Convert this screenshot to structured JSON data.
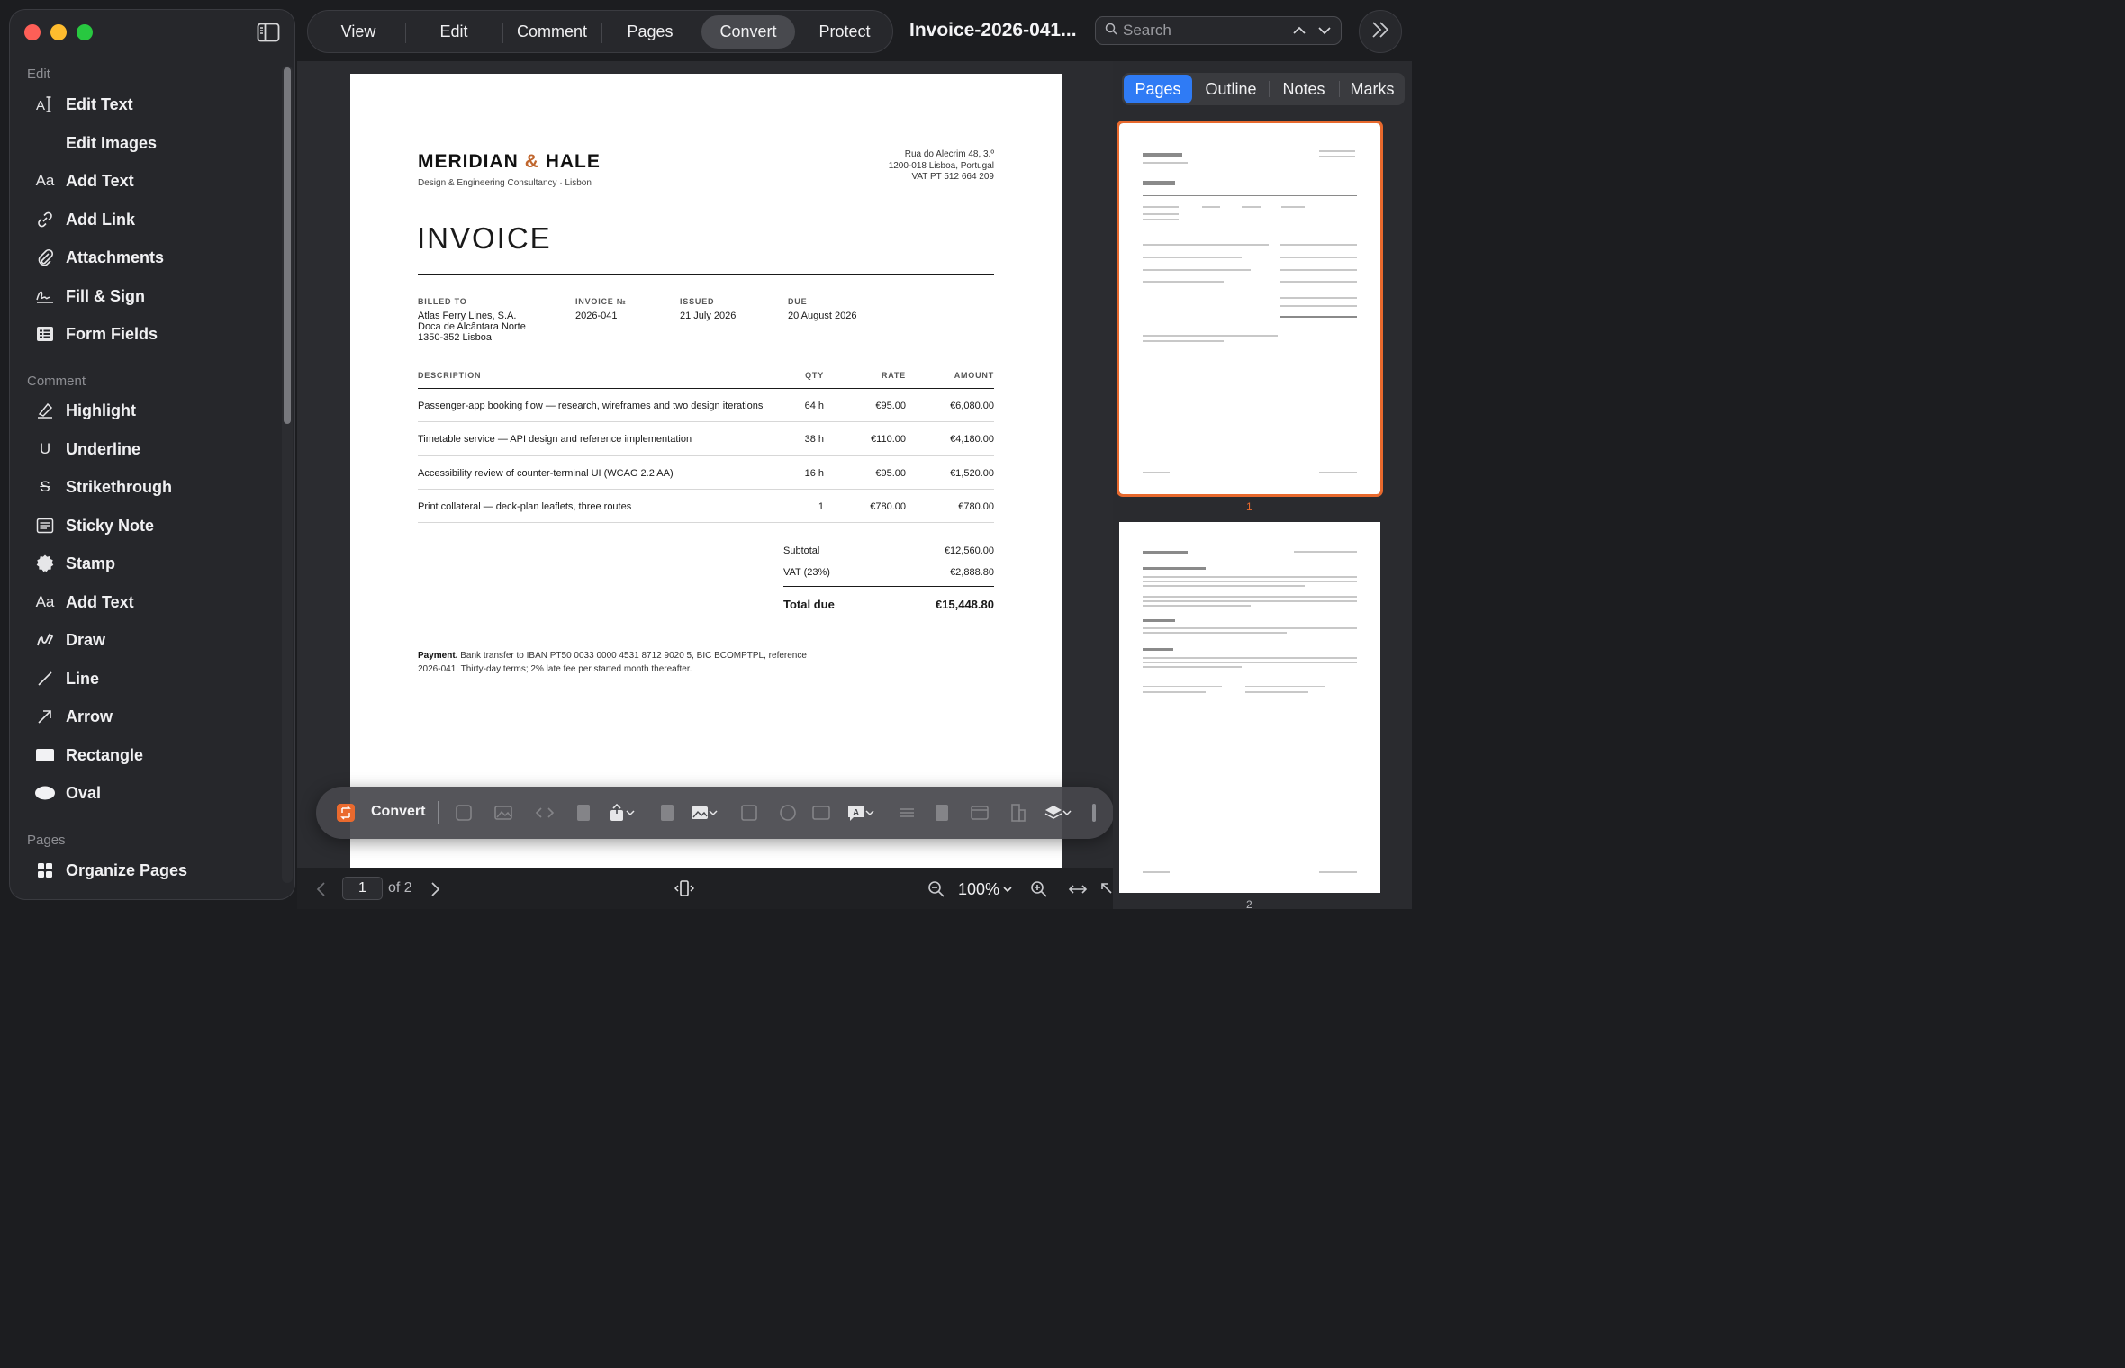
{
  "sidebar": {
    "sections": [
      {
        "label": "Edit",
        "items": [
          "Edit Text",
          "Edit Images",
          "Add Text",
          "Add Link",
          "Attachments",
          "Fill & Sign",
          "Form Fields"
        ]
      },
      {
        "label": "Comment",
        "items": [
          "Highlight",
          "Underline",
          "Strikethrough",
          "Sticky Note",
          "Stamp",
          "Add Text",
          "Draw",
          "Line",
          "Arrow",
          "Rectangle",
          "Oval"
        ]
      },
      {
        "label": "Pages",
        "items": [
          "Organize Pages"
        ]
      }
    ],
    "icon_text": {
      "add_text": "Aa",
      "underline": "U",
      "strike": "S"
    }
  },
  "toolbar": {
    "tabs": [
      "View",
      "Edit",
      "Comment",
      "Pages",
      "Convert",
      "Protect"
    ],
    "active_tab": "Convert",
    "doc_title": "Invoice-2026-041...",
    "search_placeholder": "Search"
  },
  "invoice": {
    "brand_left": "MERIDIAN",
    "brand_amp": "&",
    "brand_right": "HALE",
    "tagline": "Design & Engineering Consultancy · Lisbon",
    "address": [
      "Rua do Alecrim 48, 3.º",
      "1200-018 Lisboa, Portugal",
      "VAT PT 512 664 209"
    ],
    "heading": "INVOICE",
    "billed_to_label": "BILLED TO",
    "billed_to": [
      "Atlas Ferry Lines, S.A.",
      "Doca de Alcântara Norte",
      "1350-352 Lisboa"
    ],
    "invoice_no_label": "INVOICE №",
    "invoice_no": "2026-041",
    "issued_label": "ISSUED",
    "issued": "21 July 2026",
    "due_label": "DUE",
    "due": "20 August 2026",
    "columns": [
      "DESCRIPTION",
      "QTY",
      "RATE",
      "AMOUNT"
    ],
    "rows": [
      {
        "description": "Passenger-app booking flow — research, wireframes and two design iterations",
        "qty": "64 h",
        "rate": "€95.00",
        "amount": "€6,080.00"
      },
      {
        "description": "Timetable service — API design and reference implementation",
        "qty": "38 h",
        "rate": "€110.00",
        "amount": "€4,180.00"
      },
      {
        "description": "Accessibility review of counter-terminal UI (WCAG 2.2 AA)",
        "qty": "16 h",
        "rate": "€95.00",
        "amount": "€1,520.00"
      },
      {
        "description": "Print collateral — deck-plan leaflets, three routes",
        "qty": "1",
        "rate": "€780.00",
        "amount": "€780.00"
      }
    ],
    "subtotal_label": "Subtotal",
    "subtotal": "€12,560.00",
    "vat_label": "VAT (23%)",
    "vat": "€2,888.80",
    "total_label": "Total due",
    "total": "€15,448.80",
    "payment_label": "Payment.",
    "payment_text": "Bank transfer to IBAN PT50 0033 0000 4531 8712 9020 5, BIC BCOMPTPL, reference 2026-041. Thirty-day terms; 2% late fee per started month thereafter."
  },
  "convert_bar": {
    "label": "Convert"
  },
  "bottom_bar": {
    "page": "1",
    "of_pages": "of 2",
    "zoom": "100%"
  },
  "right_panel": {
    "tabs": [
      "Pages",
      "Outline",
      "Notes",
      "Marks"
    ],
    "active_tab": "Pages",
    "thumb_numbers": [
      "1",
      "2"
    ]
  },
  "colors": {
    "accent": "#2f7bf5",
    "selection": "#e8692d",
    "brand_amp": "#c0662d"
  }
}
